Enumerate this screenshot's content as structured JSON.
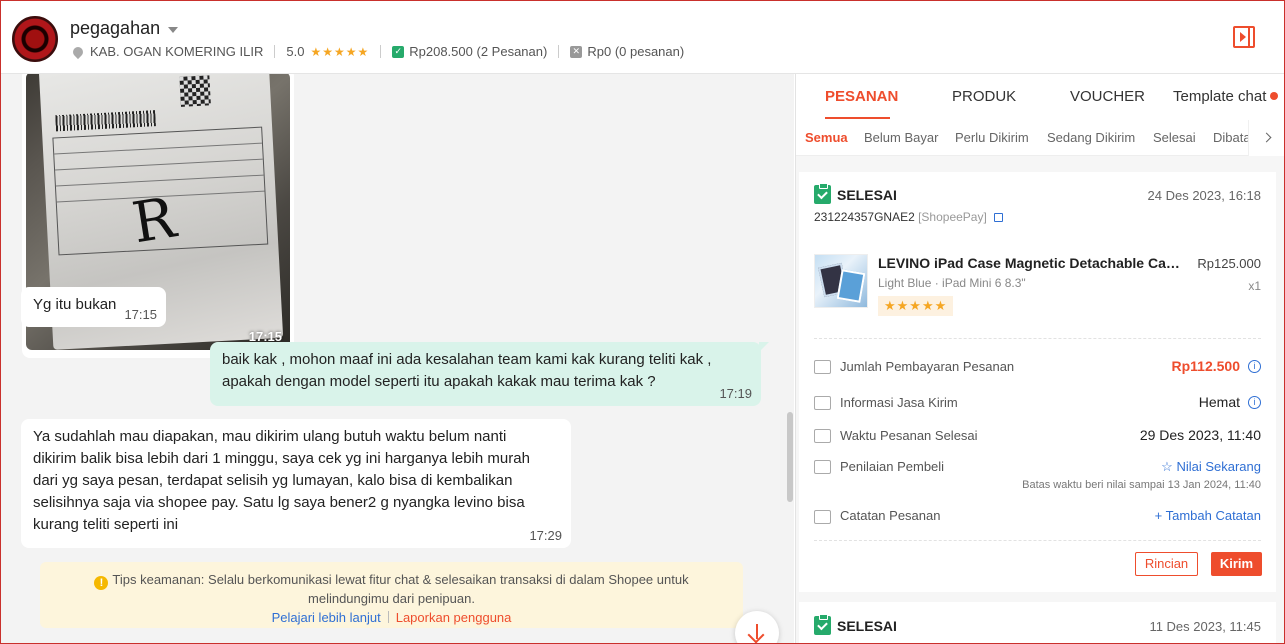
{
  "header": {
    "username": "pegagahan",
    "location": "KAB. OGAN KOMERING ILIR",
    "rating": "5.0",
    "rating_stars": "★★★★★",
    "paid_total": "Rp208.500",
    "paid_orders": "(2 Pesanan)",
    "cancel_total": "Rp0",
    "cancel_orders": "(0 pesanan)"
  },
  "chat": {
    "image_time": "17:15",
    "image_handwritten": "R",
    "messages": [
      {
        "text": "Yg itu bukan",
        "time": "17:15",
        "direction": "in"
      },
      {
        "text": "baik kak , mohon maaf ini ada kesalahan team kami kak kurang teliti kak ,\napakah dengan model seperti itu apakah kakak mau terima kak ?",
        "time": "17:19",
        "direction": "out"
      },
      {
        "text": "Ya sudahlah mau diapakan, mau dikirim ulang butuh waktu belum nanti\ndikirim balik bisa lebih dari 1 minggu, saya cek yg ini harganya lebih murah\ndari yg saya pesan, terdapat selisih yg lumayan, kalo bisa di kembalikan\nselisihnya saja via shopee pay. Satu lg saya bener2 g nyangka levino bisa\nkurang teliti seperti ini",
        "time": "17:29",
        "direction": "in"
      }
    ],
    "tips_text": "Tips keamanan: Selalu berkomunikasi lewat fitur chat & selesaikan transaksi di dalam Shopee untuk",
    "tips_text2": "melindungimu dari penipuan.",
    "tips_learn_more": "Pelajari lebih lanjut",
    "tips_report": "Laporkan pengguna"
  },
  "panel": {
    "tabs": [
      {
        "label": "PESANAN"
      },
      {
        "label": "PRODUK"
      },
      {
        "label": "VOUCHER"
      },
      {
        "label": "Template chat"
      }
    ],
    "subtabs": [
      {
        "label": "Semua"
      },
      {
        "label": "Belum Bayar"
      },
      {
        "label": "Perlu Dikirim"
      },
      {
        "label": "Sedang Dikirim"
      },
      {
        "label": "Selesai"
      },
      {
        "label": "Dibatalkan"
      }
    ],
    "order": {
      "status": "SELESAI",
      "date": "24 Des 2023, 16:18",
      "order_id": "231224357GNAE2",
      "payment": "[ShopeePay]",
      "product_name": "LEVINO iPad Case Magnetic Detachable Case...",
      "product_price": "Rp125.000",
      "variant": "Light Blue · iPad Mini 6 8.3\"",
      "qty": "x1",
      "product_stars": "★★★★★",
      "rows": {
        "payment_label": "Jumlah Pembayaran Pesanan",
        "payment_value": "Rp112.500",
        "shipping_label": "Informasi Jasa Kirim",
        "shipping_value": "Hemat",
        "completed_label": "Waktu Pesanan Selesai",
        "completed_value": "29 Des 2023, 11:40",
        "review_label": "Penilaian Pembeli",
        "review_value": "Nilai Sekarang",
        "review_hint": "Batas waktu beri nilai sampai 13 Jan 2024, 11:40",
        "note_label": "Catatan Pesanan",
        "note_value": "Tambah Catatan"
      },
      "btn_detail": "Rincian",
      "btn_send": "Kirim"
    },
    "order2": {
      "status": "SELESAI",
      "date": "11 Des 2023, 11:45"
    }
  },
  "colors": {
    "accent": "#ee4d2d",
    "success": "#26aa6b",
    "link": "#2f6fd4",
    "outgoing_bubble": "#d9f3ea",
    "tips_bg": "#fdf5dc"
  }
}
